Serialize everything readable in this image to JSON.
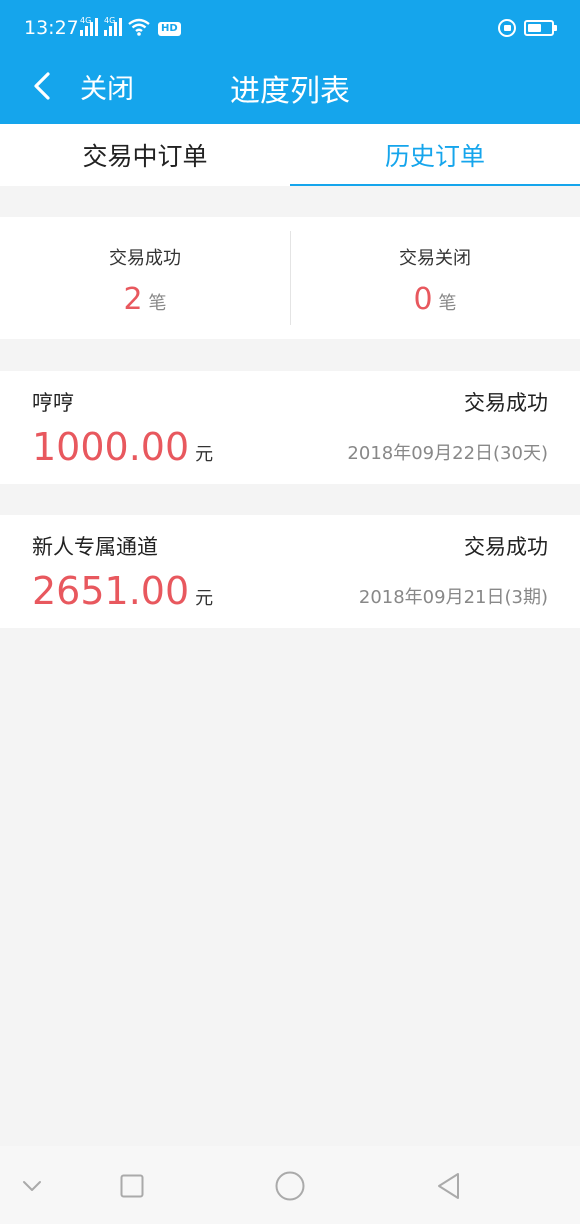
{
  "status_bar": {
    "time": "13:27",
    "signal_label_1": "4G",
    "signal_label_2": "4G",
    "hd_label": "HD",
    "battery_level": 0.6
  },
  "nav": {
    "back_icon": "chevron-left-icon",
    "close_label": "关闭",
    "title": "进度列表"
  },
  "tabs": [
    {
      "label": "交易中订单",
      "active": false
    },
    {
      "label": "历史订单",
      "active": true
    }
  ],
  "summary": [
    {
      "label": "交易成功",
      "count": "2",
      "unit": "笔"
    },
    {
      "label": "交易关闭",
      "count": "0",
      "unit": "笔"
    }
  ],
  "orders": [
    {
      "name": "哼哼",
      "status": "交易成功",
      "amount": "1000.00",
      "currency": "元",
      "date": "2018年09月22日(30天)"
    },
    {
      "name": "新人专属通道",
      "status": "交易成功",
      "amount": "2651.00",
      "currency": "元",
      "date": "2018年09月21日(3期)"
    }
  ],
  "colors": {
    "primary": "#15a5ec",
    "accent_red": "#e8585e",
    "background": "#f4f4f4"
  }
}
